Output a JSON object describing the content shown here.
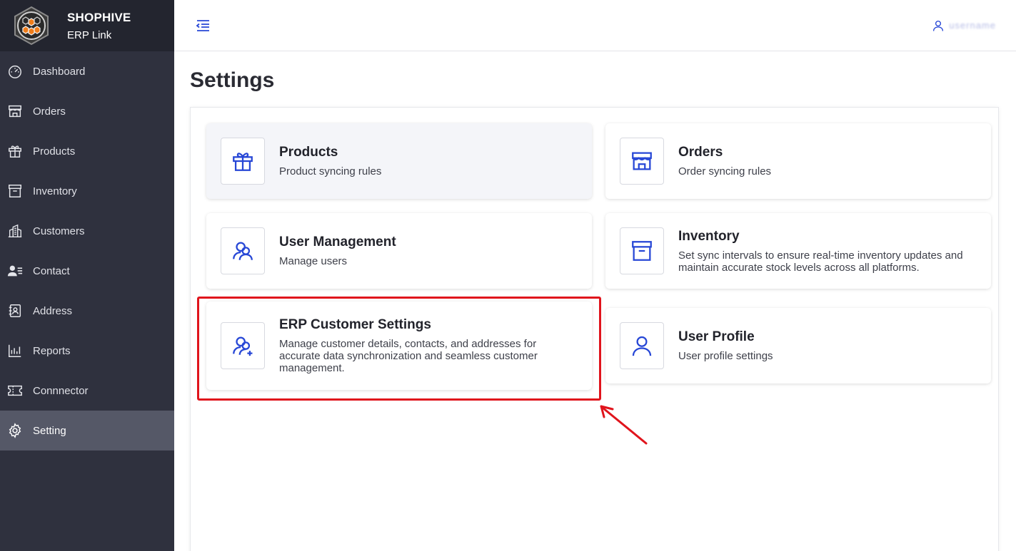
{
  "brand": {
    "name": "SHOPHIVE",
    "subtitle": "ERP Link"
  },
  "sidebar": {
    "items": [
      {
        "label": "Dashboard",
        "icon": "dashboard-icon"
      },
      {
        "label": "Orders",
        "icon": "store-icon"
      },
      {
        "label": "Products",
        "icon": "gift-icon"
      },
      {
        "label": "Inventory",
        "icon": "archive-icon"
      },
      {
        "label": "Customers",
        "icon": "building-icon"
      },
      {
        "label": "Contact",
        "icon": "contact-icon"
      },
      {
        "label": "Address",
        "icon": "address-book-icon"
      },
      {
        "label": "Reports",
        "icon": "bar-chart-icon"
      },
      {
        "label": "Connnector",
        "icon": "ticket-icon"
      },
      {
        "label": "Setting",
        "icon": "gear-icon",
        "active": true
      }
    ]
  },
  "header": {
    "user_name": "username"
  },
  "page": {
    "title": "Settings"
  },
  "cards": {
    "products": {
      "title": "Products",
      "description": "Product syncing rules"
    },
    "orders": {
      "title": "Orders",
      "description": "Order syncing rules"
    },
    "user_management": {
      "title": "User Management",
      "description": "Manage users"
    },
    "inventory": {
      "title": "Inventory",
      "description": "Set sync intervals to ensure real-time inventory updates and maintain accurate stock levels across all platforms."
    },
    "erp_customer": {
      "title": "ERP Customer Settings",
      "description": "Manage customer details, contacts, and addresses for accurate data synchronization and seamless customer management."
    },
    "user_profile": {
      "title": "User Profile",
      "description": "User profile settings"
    }
  },
  "colors": {
    "accent": "#2747d6",
    "sidebar_bg": "#2f313e",
    "highlight": "#e0141c"
  }
}
